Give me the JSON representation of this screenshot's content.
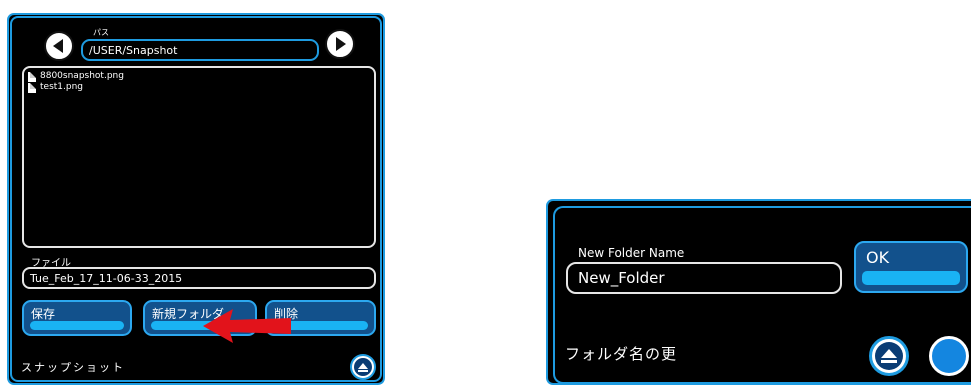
{
  "file_dialog": {
    "path_label": "パス",
    "path_value": "/USER/Snapshot",
    "files": [
      "8800snapshot.png",
      "test1.png"
    ],
    "file_label": "ファイル",
    "file_value": "Tue_Feb_17_11-06-33_2015",
    "save_button": "保存",
    "new_folder_button": "新規フォルダ",
    "delete_button": "削除",
    "footer_title": "スナップショット"
  },
  "rename_dialog": {
    "field_label": "New Folder Name",
    "field_value": "New_Folder",
    "ok_button": "OK",
    "footer_title": "フォルダ名の更"
  },
  "colors": {
    "accent_blue": "#1e9be0",
    "button_blue": "#12518c",
    "button_bar": "#19b3f4",
    "arrow_red": "#e2131b",
    "background": "#000000"
  },
  "icons": {
    "back": "chevron-left-icon",
    "forward": "chevron-right-icon",
    "eject": "eject-icon",
    "annotation": "red-arrow-icon"
  }
}
